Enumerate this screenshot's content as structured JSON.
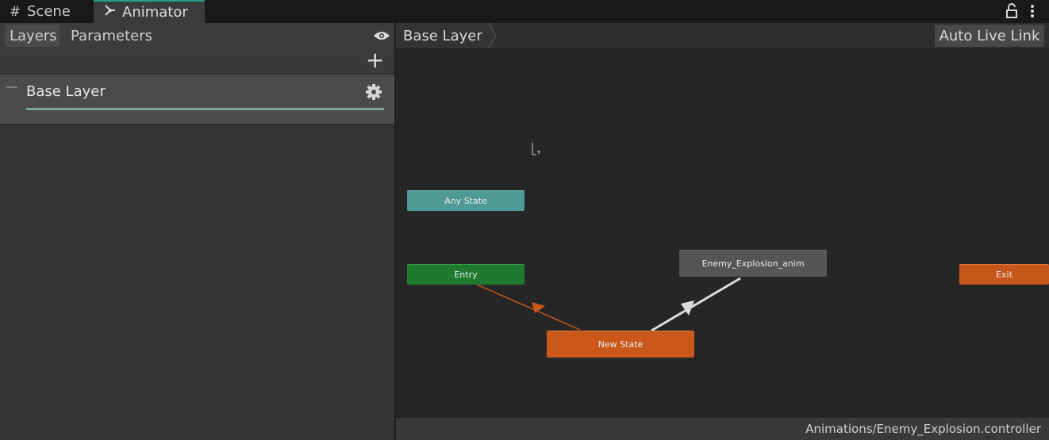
{
  "tabs": {
    "scene": {
      "label": "Scene",
      "icon": "hash-icon"
    },
    "animator": {
      "label": "Animator",
      "icon": "animator-icon"
    }
  },
  "left_panel": {
    "tabs": [
      "Layers",
      "Parameters"
    ],
    "active_tab": "Layers",
    "layers": [
      {
        "name": "Base Layer"
      }
    ]
  },
  "graph": {
    "breadcrumb": "Base Layer",
    "auto_live_link_label": "Auto Live Link",
    "nodes": {
      "any_state": "Any State",
      "entry": "Entry",
      "exit": "Exit",
      "new_state": "New State",
      "enemy_explosion": "Enemy_Explosion_anim"
    },
    "controller_path": "Animations/Enemy_Explosion.controller"
  },
  "colors": {
    "accent": "#2a9d8f",
    "any_state": "#4e9a97",
    "entry": "#1f7a2f",
    "default_state": "#c9581a",
    "state": "#555555",
    "transition_entry": "#c9581a",
    "transition": "#dcdcdc"
  }
}
